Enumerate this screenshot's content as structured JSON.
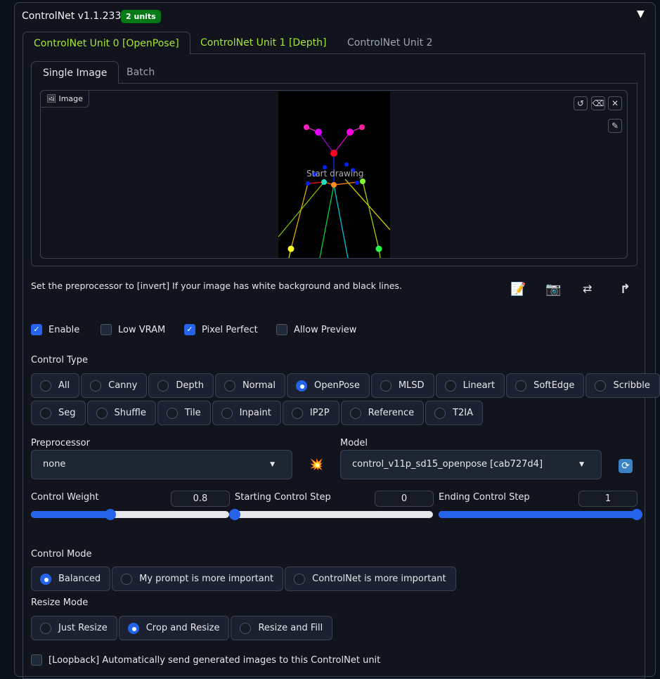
{
  "header": {
    "title": "ControlNet v1.1.233",
    "badge": "2 units",
    "collapse_icon": "▼"
  },
  "unit_tabs": [
    {
      "label": "ControlNet Unit 0 [OpenPose]",
      "color": "#a3e635"
    },
    {
      "label": "ControlNet Unit 1 [Depth]",
      "color": "#a3e635"
    },
    {
      "label": "ControlNet Unit 2",
      "color": "#9ca3af"
    }
  ],
  "sub_tabs": [
    "Single Image",
    "Batch"
  ],
  "image": {
    "label": "Image",
    "overlay": "Start drawing"
  },
  "hint": "Set the preprocessor to [invert] If your image has white background and black lines.",
  "checkboxes": [
    {
      "label": "Enable",
      "checked": true
    },
    {
      "label": "Low VRAM",
      "checked": false
    },
    {
      "label": "Pixel Perfect",
      "checked": true
    },
    {
      "label": "Allow Preview",
      "checked": false
    }
  ],
  "control_type": {
    "label": "Control Type",
    "row1": [
      "All",
      "Canny",
      "Depth",
      "Normal",
      "OpenPose",
      "MLSD",
      "Lineart",
      "SoftEdge",
      "Scribble"
    ],
    "row2": [
      "Seg",
      "Shuffle",
      "Tile",
      "Inpaint",
      "IP2P",
      "Reference",
      "T2IA"
    ],
    "selected": "OpenPose"
  },
  "preprocessor": {
    "label": "Preprocessor",
    "value": "none"
  },
  "model": {
    "label": "Model",
    "value": "control_v11p_sd15_openpose [cab727d4]"
  },
  "sliders": [
    {
      "label": "Control Weight",
      "value": "0.8",
      "fraction": 0.4
    },
    {
      "label": "Starting Control Step",
      "value": "0",
      "fraction": 0
    },
    {
      "label": "Ending Control Step",
      "value": "1",
      "fraction": 1
    }
  ],
  "control_mode": {
    "label": "Control Mode",
    "options": [
      "Balanced",
      "My prompt is more important",
      "ControlNet is more important"
    ],
    "selected": "Balanced"
  },
  "resize_mode": {
    "label": "Resize Mode",
    "options": [
      "Just Resize",
      "Crop and Resize",
      "Resize and Fill"
    ],
    "selected": "Crop and Resize"
  },
  "loopback": {
    "label": "[Loopback] Automatically send generated images to this ControlNet unit",
    "checked": false
  }
}
